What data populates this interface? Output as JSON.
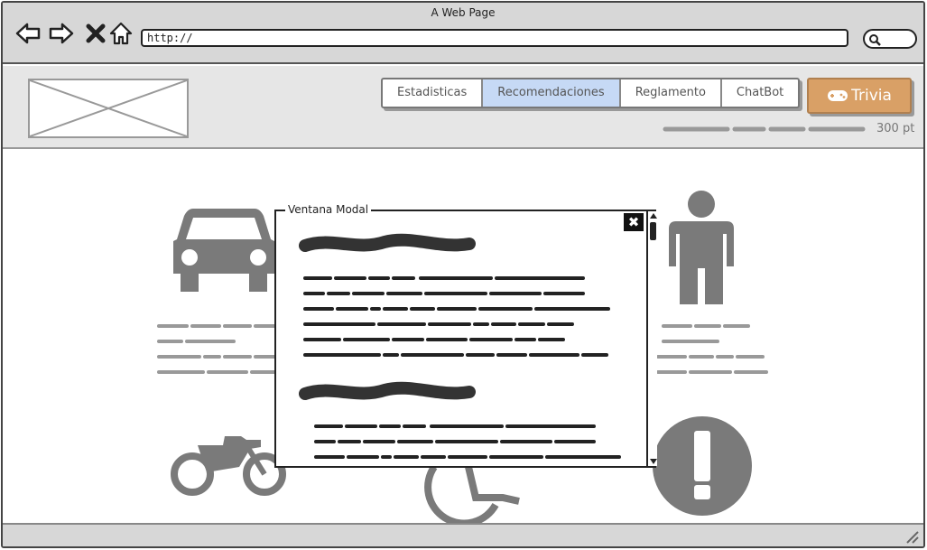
{
  "window": {
    "title": "A Web Page"
  },
  "browser": {
    "url": "http://",
    "nav_icons": [
      "back-arrow-icon",
      "forward-arrow-icon",
      "close-x-icon",
      "home-icon"
    ],
    "search_icon": "magnifier-icon"
  },
  "header": {
    "tabs": [
      {
        "label": "Estadisticas",
        "active": false
      },
      {
        "label": "Recomendaciones",
        "active": true
      },
      {
        "label": "Reglamento",
        "active": false
      },
      {
        "label": "ChatBot",
        "active": false
      }
    ],
    "trivia_button": {
      "label": "Trivia",
      "icon": "gamepad-icon"
    },
    "points": "300 pt"
  },
  "content": {
    "icons": [
      "car-icon",
      "person-icon",
      "motorcycle-icon",
      "wheelchair-icon",
      "warning-icon"
    ]
  },
  "modal": {
    "title": "Ventana Modal",
    "close_label": "✖"
  },
  "colors": {
    "active_tab": "#c6d9f5",
    "trivia_button": "#d9a066",
    "icon_gray": "#7a7a7a",
    "chrome_gray": "#d7d7d7"
  }
}
